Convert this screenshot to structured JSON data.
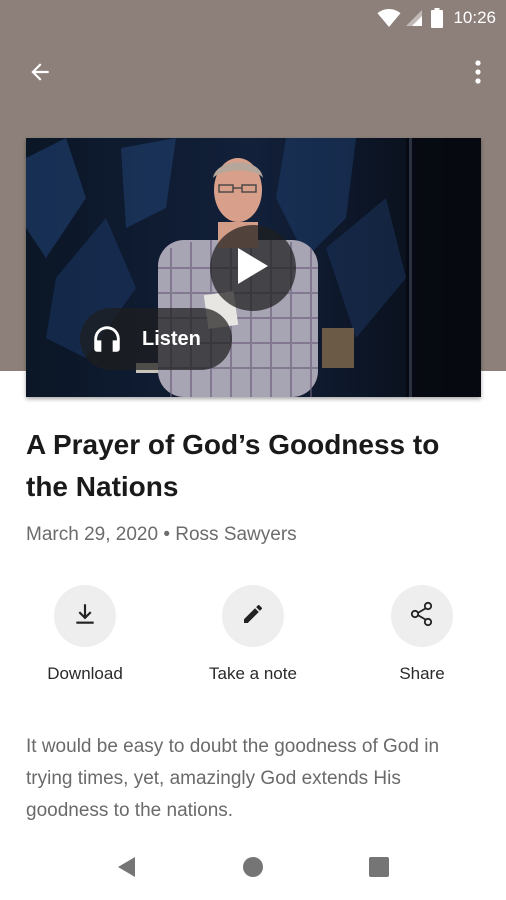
{
  "status_bar": {
    "time": "10:26",
    "icons": [
      "wifi-icon",
      "signal-icon",
      "battery-icon"
    ]
  },
  "app_bar": {
    "back_icon": "arrow-back-icon",
    "menu_icon": "more-vert-icon"
  },
  "media": {
    "play_icon": "play-icon",
    "listen_label": "Listen",
    "listen_icon": "headphones-icon"
  },
  "sermon": {
    "title": "A Prayer of God’s Goodness to the Nations",
    "date": "March 29, 2020",
    "separator": "•",
    "speaker": "Ross Sawyers",
    "description": "It would be easy to doubt the goodness of God in trying times, yet, amazingly God extends His goodness to the nations."
  },
  "actions": [
    {
      "label": "Download",
      "icon": "download-icon"
    },
    {
      "label": "Take a note",
      "icon": "pencil-icon"
    },
    {
      "label": "Share",
      "icon": "share-icon"
    }
  ],
  "nav": {
    "icons": [
      "back-triangle-icon",
      "home-circle-icon",
      "recents-square-icon"
    ]
  },
  "colors": {
    "header": "#8d807a",
    "title": "#1a1a1a",
    "meta": "#6c6c6c",
    "action_circle": "#eeeeee",
    "nav_icons": "#757575"
  }
}
